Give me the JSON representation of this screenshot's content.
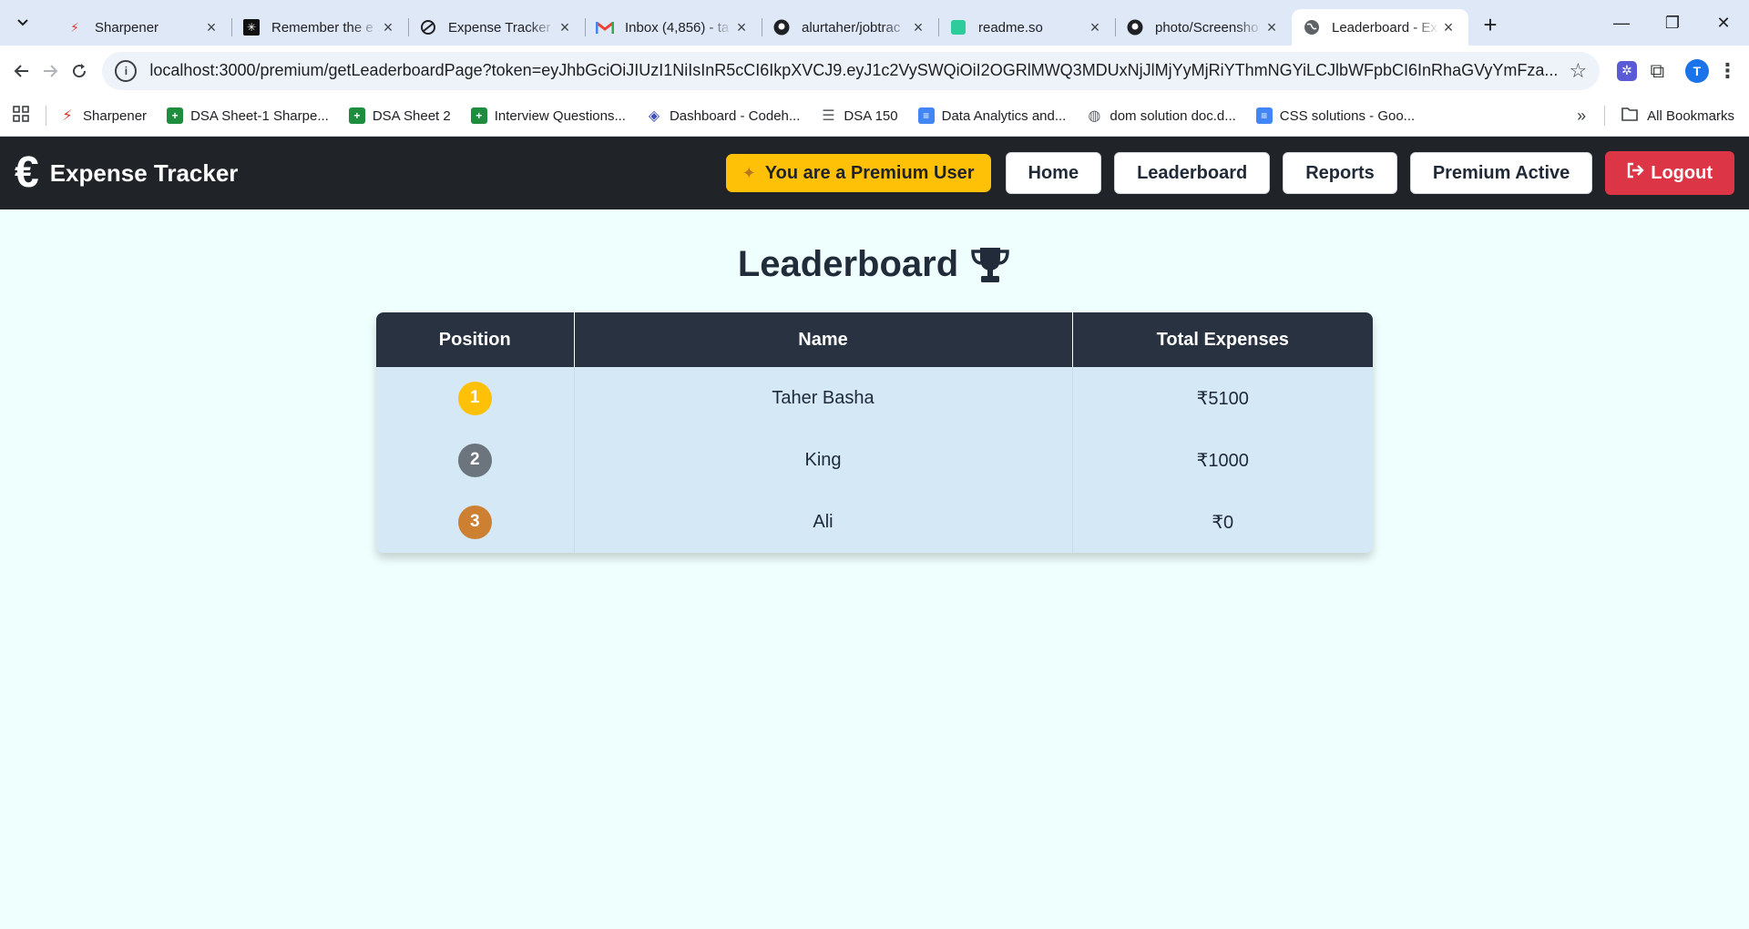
{
  "browser": {
    "tabs": [
      {
        "label": "Sharpener",
        "icon": "sharpener-icon",
        "active": false
      },
      {
        "label": "Remember the e",
        "icon": "perplexity-icon",
        "active": false
      },
      {
        "label": "Expense Tracker",
        "icon": "chatgpt-icon",
        "active": false
      },
      {
        "label": "Inbox (4,856) - ta",
        "icon": "gmail-icon",
        "active": false
      },
      {
        "label": "alurtaher/jobtrac",
        "icon": "github-icon",
        "active": false
      },
      {
        "label": "readme.so",
        "icon": "readme-icon",
        "active": false
      },
      {
        "label": "photo/Screensho",
        "icon": "github-icon",
        "active": false
      },
      {
        "label": "Leaderboard - Ex",
        "icon": "globe-icon",
        "active": true
      }
    ],
    "url": "localhost:3000/premium/getLeaderboardPage?token=eyJhbGciOiJIUzI1NiIsInR5cCI6IkpXVCJ9.eyJ1c2VySWQiOiI2OGRlMWQ3MDUxNjJlMjYyMjRiYThmNGYiLCJlbWFpbCI6InRhaGVyYmFza...",
    "profile_initial": "T",
    "bookmarks": [
      {
        "label": "Sharpener",
        "icon": "sharpener-icon"
      },
      {
        "label": "DSA Sheet-1 Sharpe...",
        "icon": "sheets-icon"
      },
      {
        "label": "DSA Sheet 2",
        "icon": "sheets-icon"
      },
      {
        "label": "Interview Questions...",
        "icon": "sheets-icon"
      },
      {
        "label": "Dashboard - Codeh...",
        "icon": "codehelp-icon"
      },
      {
        "label": "DSA 150",
        "icon": "list-icon"
      },
      {
        "label": "Data Analytics and...",
        "icon": "docs-icon"
      },
      {
        "label": "dom solution doc.d...",
        "icon": "globe-icon"
      },
      {
        "label": "CSS solutions - Goo...",
        "icon": "docs-icon"
      }
    ],
    "all_bookmarks_label": "All Bookmarks"
  },
  "app": {
    "brand": "Expense Tracker",
    "premium_badge": "You are a Premium User",
    "nav": {
      "home": "Home",
      "leaderboard": "Leaderboard",
      "reports": "Reports",
      "premium_active": "Premium Active",
      "logout": "Logout"
    },
    "colors": {
      "navbar": "#202328",
      "premium": "#ffc107",
      "logout": "#dc3545",
      "table_header": "#283241",
      "table_row": "#d4e8f5",
      "gold": "#ffc107",
      "silver": "#6c757d",
      "bronze": "#cd7f32"
    }
  },
  "leaderboard": {
    "title": "Leaderboard",
    "columns": [
      "Position",
      "Name",
      "Total Expenses"
    ],
    "rows": [
      {
        "position": "1",
        "name": "Taher Basha",
        "total": "₹5100",
        "badge_color": "#ffc107"
      },
      {
        "position": "2",
        "name": "King",
        "total": "₹1000",
        "badge_color": "#6c757d"
      },
      {
        "position": "3",
        "name": "Ali",
        "total": "₹0",
        "badge_color": "#cd7f32"
      }
    ]
  }
}
